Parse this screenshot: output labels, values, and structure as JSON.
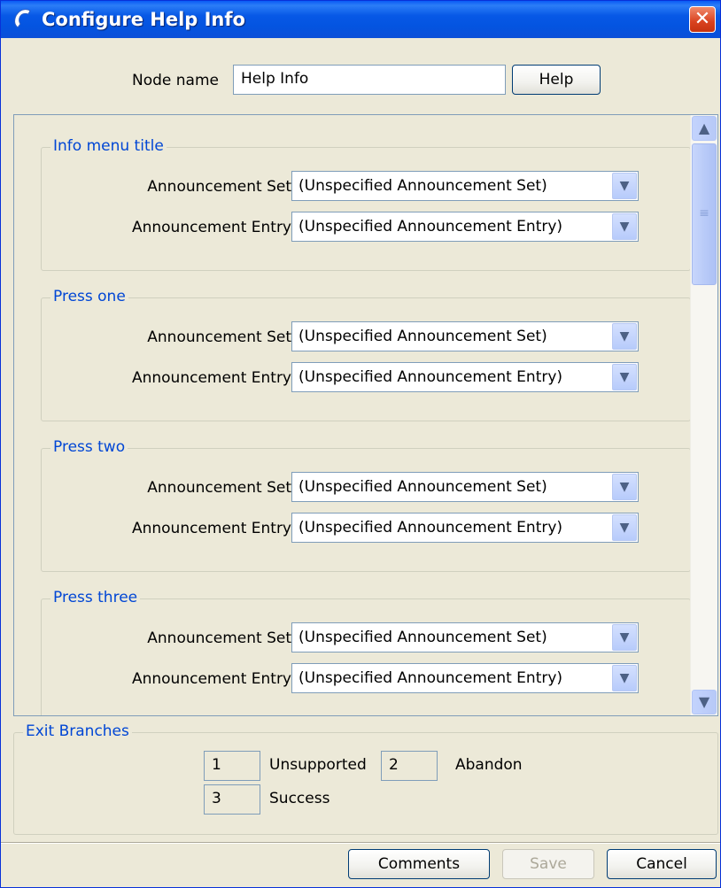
{
  "window": {
    "title": "Configure Help Info",
    "close_symbol": "✕",
    "icon": "phone-handset-icon"
  },
  "node": {
    "label": "Node name",
    "value": "Help Info",
    "help_label": "Help"
  },
  "groups": [
    {
      "title": "Info menu title",
      "set_label": "Announcement Set",
      "set_value": "(Unspecified Announcement Set)",
      "entry_label": "Announcement Entry",
      "entry_value": "(Unspecified Announcement Entry)"
    },
    {
      "title": "Press one",
      "set_label": "Announcement Set",
      "set_value": "(Unspecified Announcement Set)",
      "entry_label": "Announcement Entry",
      "entry_value": "(Unspecified Announcement Entry)"
    },
    {
      "title": "Press two",
      "set_label": "Announcement Set",
      "set_value": "(Unspecified Announcement Set)",
      "entry_label": "Announcement Entry",
      "entry_value": "(Unspecified Announcement Entry)"
    },
    {
      "title": "Press three",
      "set_label": "Announcement Set",
      "set_value": "(Unspecified Announcement Set)",
      "entry_label": "Announcement Entry",
      "entry_value": "(Unspecified Announcement Entry)"
    }
  ],
  "exit_branches": {
    "title": "Exit Branches",
    "items": [
      {
        "number": "1",
        "label": "Unsupported"
      },
      {
        "number": "2",
        "label": "Abandon"
      },
      {
        "number": "3",
        "label": "Success"
      }
    ]
  },
  "footer": {
    "comments_label": "Comments",
    "save_label": "Save",
    "cancel_label": "Cancel"
  },
  "colors": {
    "titlebar": "#0758e6",
    "group_title": "#0046d5",
    "close_button": "#d9421f"
  }
}
